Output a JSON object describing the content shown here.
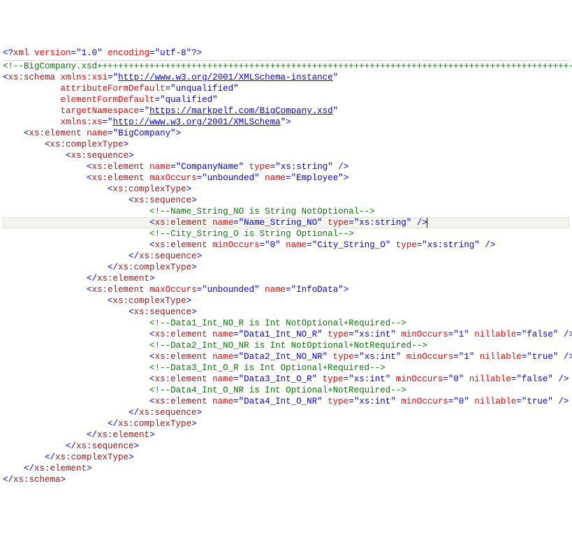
{
  "code_lines": [
    {
      "indent": 0,
      "tokens": [
        {
          "t": "<?",
          "c": "p"
        },
        {
          "t": "xml ",
          "c": "xml"
        },
        {
          "t": "version",
          "c": "attr"
        },
        {
          "t": "=",
          "c": "p"
        },
        {
          "t": "\"1.0\"",
          "c": "str"
        },
        {
          "t": " ",
          "c": "p"
        },
        {
          "t": "encoding",
          "c": "attr"
        },
        {
          "t": "=",
          "c": "p"
        },
        {
          "t": "\"utf-8\"",
          "c": "str"
        },
        {
          "t": "?>",
          "c": "p"
        }
      ]
    },
    {
      "indent": 0,
      "rule": true,
      "tokens": [
        {
          "t": "<!--",
          "c": "com"
        },
        {
          "t": "BigCompany.xsd++++++++++++++++++++++++++++++++++++++++++++++++++++++++++++++++++++++++++++++++++++++++++",
          "c": "com"
        },
        {
          "t": "-->",
          "c": "com"
        }
      ]
    },
    {
      "indent": 0,
      "tokens": [
        {
          "t": "<",
          "c": "p"
        },
        {
          "t": "xs:schema",
          "c": "tag"
        },
        {
          "t": " ",
          "c": "p"
        },
        {
          "t": "xmlns:xsi",
          "c": "attr"
        },
        {
          "t": "=",
          "c": "p"
        },
        {
          "t": "\"",
          "c": "p"
        },
        {
          "t": "http://www.w3.org/2001/XMLSchema-instance",
          "c": "link"
        },
        {
          "t": "\"",
          "c": "p"
        }
      ]
    },
    {
      "indent": 11,
      "tokens": [
        {
          "t": "attributeFormDefault",
          "c": "attr"
        },
        {
          "t": "=",
          "c": "p"
        },
        {
          "t": "\"unqualified\"",
          "c": "str"
        }
      ]
    },
    {
      "indent": 11,
      "tokens": [
        {
          "t": "elementFormDefault",
          "c": "attr"
        },
        {
          "t": "=",
          "c": "p"
        },
        {
          "t": "\"qualified\"",
          "c": "str"
        }
      ]
    },
    {
      "indent": 11,
      "tokens": [
        {
          "t": "targetNamespace",
          "c": "attr"
        },
        {
          "t": "=",
          "c": "p"
        },
        {
          "t": "\"",
          "c": "p"
        },
        {
          "t": "https://markpelf.com/BigCompany.xsd",
          "c": "link"
        },
        {
          "t": "\"",
          "c": "p"
        }
      ]
    },
    {
      "indent": 11,
      "tokens": [
        {
          "t": "xmlns:xs",
          "c": "attr"
        },
        {
          "t": "=",
          "c": "p"
        },
        {
          "t": "\"",
          "c": "p"
        },
        {
          "t": "http://www.w3.org/2001/XMLSchema",
          "c": "link"
        },
        {
          "t": "\"",
          "c": "p"
        },
        {
          "t": ">",
          "c": "p"
        }
      ]
    },
    {
      "indent": 4,
      "tokens": [
        {
          "t": "<",
          "c": "p"
        },
        {
          "t": "xs:element",
          "c": "tag"
        },
        {
          "t": " ",
          "c": "p"
        },
        {
          "t": "name",
          "c": "attr"
        },
        {
          "t": "=",
          "c": "p"
        },
        {
          "t": "\"BigCompany\"",
          "c": "str"
        },
        {
          "t": ">",
          "c": "p"
        }
      ]
    },
    {
      "indent": 8,
      "tokens": [
        {
          "t": "<",
          "c": "p"
        },
        {
          "t": "xs:complexType",
          "c": "tag"
        },
        {
          "t": ">",
          "c": "p"
        }
      ]
    },
    {
      "indent": 12,
      "tokens": [
        {
          "t": "<",
          "c": "p"
        },
        {
          "t": "xs:sequence",
          "c": "tag"
        },
        {
          "t": ">",
          "c": "p"
        }
      ]
    },
    {
      "indent": 16,
      "tokens": [
        {
          "t": "<",
          "c": "p"
        },
        {
          "t": "xs:element",
          "c": "tag"
        },
        {
          "t": " ",
          "c": "p"
        },
        {
          "t": "name",
          "c": "attr"
        },
        {
          "t": "=",
          "c": "p"
        },
        {
          "t": "\"CompanyName\"",
          "c": "str"
        },
        {
          "t": " ",
          "c": "p"
        },
        {
          "t": "type",
          "c": "attr"
        },
        {
          "t": "=",
          "c": "p"
        },
        {
          "t": "\"xs:string\"",
          "c": "str"
        },
        {
          "t": " />",
          "c": "p"
        }
      ]
    },
    {
      "indent": 16,
      "tokens": [
        {
          "t": "<",
          "c": "p"
        },
        {
          "t": "xs:element",
          "c": "tag"
        },
        {
          "t": " ",
          "c": "p"
        },
        {
          "t": "maxOccurs",
          "c": "attr"
        },
        {
          "t": "=",
          "c": "p"
        },
        {
          "t": "\"unbounded\"",
          "c": "str"
        },
        {
          "t": " ",
          "c": "p"
        },
        {
          "t": "name",
          "c": "attr"
        },
        {
          "t": "=",
          "c": "p"
        },
        {
          "t": "\"Employee\"",
          "c": "str"
        },
        {
          "t": ">",
          "c": "p"
        }
      ]
    },
    {
      "indent": 20,
      "tokens": [
        {
          "t": "<",
          "c": "p"
        },
        {
          "t": "xs:complexType",
          "c": "tag"
        },
        {
          "t": ">",
          "c": "p"
        }
      ]
    },
    {
      "indent": 24,
      "tokens": [
        {
          "t": "<",
          "c": "p"
        },
        {
          "t": "xs:sequence",
          "c": "tag"
        },
        {
          "t": ">",
          "c": "p"
        }
      ]
    },
    {
      "indent": 28,
      "tokens": [
        {
          "t": "<!--",
          "c": "com"
        },
        {
          "t": "Name_String_NO is String NotOptional",
          "c": "com"
        },
        {
          "t": "-->",
          "c": "com"
        }
      ]
    },
    {
      "indent": 28,
      "highlight": true,
      "cursor_at_end": true,
      "tokens": [
        {
          "t": "<",
          "c": "p"
        },
        {
          "t": "xs:element",
          "c": "tag"
        },
        {
          "t": " ",
          "c": "p"
        },
        {
          "t": "name",
          "c": "attr"
        },
        {
          "t": "=",
          "c": "p"
        },
        {
          "t": "\"Name_String_NO\"",
          "c": "str"
        },
        {
          "t": " ",
          "c": "p"
        },
        {
          "t": "type",
          "c": "attr"
        },
        {
          "t": "=",
          "c": "p"
        },
        {
          "t": "\"xs:string\"",
          "c": "str"
        },
        {
          "t": " />",
          "c": "p"
        }
      ]
    },
    {
      "indent": 28,
      "tokens": [
        {
          "t": "<!--",
          "c": "com"
        },
        {
          "t": "City_String_O is String Optional",
          "c": "com"
        },
        {
          "t": "-->",
          "c": "com"
        }
      ]
    },
    {
      "indent": 28,
      "tokens": [
        {
          "t": "<",
          "c": "p"
        },
        {
          "t": "xs:element",
          "c": "tag"
        },
        {
          "t": " ",
          "c": "p"
        },
        {
          "t": "minOccurs",
          "c": "attr"
        },
        {
          "t": "=",
          "c": "p"
        },
        {
          "t": "\"0\"",
          "c": "str"
        },
        {
          "t": " ",
          "c": "p"
        },
        {
          "t": "name",
          "c": "attr"
        },
        {
          "t": "=",
          "c": "p"
        },
        {
          "t": "\"City_String_O\"",
          "c": "str"
        },
        {
          "t": " ",
          "c": "p"
        },
        {
          "t": "type",
          "c": "attr"
        },
        {
          "t": "=",
          "c": "p"
        },
        {
          "t": "\"xs:string\"",
          "c": "str"
        },
        {
          "t": " />",
          "c": "p"
        }
      ]
    },
    {
      "indent": 24,
      "tokens": [
        {
          "t": "</",
          "c": "p"
        },
        {
          "t": "xs:sequence",
          "c": "tag"
        },
        {
          "t": ">",
          "c": "p"
        }
      ]
    },
    {
      "indent": 20,
      "tokens": [
        {
          "t": "</",
          "c": "p"
        },
        {
          "t": "xs:complexType",
          "c": "tag"
        },
        {
          "t": ">",
          "c": "p"
        }
      ]
    },
    {
      "indent": 16,
      "tokens": [
        {
          "t": "</",
          "c": "p"
        },
        {
          "t": "xs:element",
          "c": "tag"
        },
        {
          "t": ">",
          "c": "p"
        }
      ]
    },
    {
      "indent": 16,
      "tokens": [
        {
          "t": "<",
          "c": "p"
        },
        {
          "t": "xs:element",
          "c": "tag"
        },
        {
          "t": " ",
          "c": "p"
        },
        {
          "t": "maxOccurs",
          "c": "attr"
        },
        {
          "t": "=",
          "c": "p"
        },
        {
          "t": "\"unbounded\"",
          "c": "str"
        },
        {
          "t": " ",
          "c": "p"
        },
        {
          "t": "name",
          "c": "attr"
        },
        {
          "t": "=",
          "c": "p"
        },
        {
          "t": "\"InfoData\"",
          "c": "str"
        },
        {
          "t": ">",
          "c": "p"
        }
      ]
    },
    {
      "indent": 20,
      "tokens": [
        {
          "t": "<",
          "c": "p"
        },
        {
          "t": "xs:complexType",
          "c": "tag"
        },
        {
          "t": ">",
          "c": "p"
        }
      ]
    },
    {
      "indent": 24,
      "tokens": [
        {
          "t": "<",
          "c": "p"
        },
        {
          "t": "xs:sequence",
          "c": "tag"
        },
        {
          "t": ">",
          "c": "p"
        }
      ]
    },
    {
      "indent": 28,
      "tokens": [
        {
          "t": "<!--",
          "c": "com"
        },
        {
          "t": "Data1_Int_NO_R is Int NotOptional+Required",
          "c": "com"
        },
        {
          "t": "-->",
          "c": "com"
        }
      ]
    },
    {
      "indent": 28,
      "tokens": [
        {
          "t": "<",
          "c": "p"
        },
        {
          "t": "xs:element",
          "c": "tag"
        },
        {
          "t": " ",
          "c": "p"
        },
        {
          "t": "name",
          "c": "attr"
        },
        {
          "t": "=",
          "c": "p"
        },
        {
          "t": "\"Data1_Int_NO_R\"",
          "c": "str"
        },
        {
          "t": " ",
          "c": "p"
        },
        {
          "t": "type",
          "c": "attr"
        },
        {
          "t": "=",
          "c": "p"
        },
        {
          "t": "\"xs:int\"",
          "c": "str"
        },
        {
          "t": " ",
          "c": "p"
        },
        {
          "t": "minOccurs",
          "c": "attr"
        },
        {
          "t": "=",
          "c": "p"
        },
        {
          "t": "\"1\"",
          "c": "str"
        },
        {
          "t": " ",
          "c": "p"
        },
        {
          "t": "nillable",
          "c": "attr"
        },
        {
          "t": "=",
          "c": "p"
        },
        {
          "t": "\"false\"",
          "c": "str"
        },
        {
          "t": " />",
          "c": "p"
        }
      ]
    },
    {
      "indent": 28,
      "tokens": [
        {
          "t": "<!--",
          "c": "com"
        },
        {
          "t": "Data2_Int_NO_NR is Int NotOptional+NotRequired",
          "c": "com"
        },
        {
          "t": "-->",
          "c": "com"
        }
      ]
    },
    {
      "indent": 28,
      "tokens": [
        {
          "t": "<",
          "c": "p"
        },
        {
          "t": "xs:element",
          "c": "tag"
        },
        {
          "t": " ",
          "c": "p"
        },
        {
          "t": "name",
          "c": "attr"
        },
        {
          "t": "=",
          "c": "p"
        },
        {
          "t": "\"Data2_Int_NO_NR\"",
          "c": "str"
        },
        {
          "t": " ",
          "c": "p"
        },
        {
          "t": "type",
          "c": "attr"
        },
        {
          "t": "=",
          "c": "p"
        },
        {
          "t": "\"xs:int\"",
          "c": "str"
        },
        {
          "t": " ",
          "c": "p"
        },
        {
          "t": "minOccurs",
          "c": "attr"
        },
        {
          "t": "=",
          "c": "p"
        },
        {
          "t": "\"1\"",
          "c": "str"
        },
        {
          "t": " ",
          "c": "p"
        },
        {
          "t": "nillable",
          "c": "attr"
        },
        {
          "t": "=",
          "c": "p"
        },
        {
          "t": "\"true\"",
          "c": "str"
        },
        {
          "t": " />",
          "c": "p"
        }
      ]
    },
    {
      "indent": 28,
      "tokens": [
        {
          "t": "<!--",
          "c": "com"
        },
        {
          "t": "Data3_Int_O_R is Int Optional+Required",
          "c": "com"
        },
        {
          "t": "-->",
          "c": "com"
        }
      ]
    },
    {
      "indent": 28,
      "tokens": [
        {
          "t": "<",
          "c": "p"
        },
        {
          "t": "xs:element",
          "c": "tag"
        },
        {
          "t": " ",
          "c": "p"
        },
        {
          "t": "name",
          "c": "attr"
        },
        {
          "t": "=",
          "c": "p"
        },
        {
          "t": "\"Data3_Int_O_R\"",
          "c": "str"
        },
        {
          "t": " ",
          "c": "p"
        },
        {
          "t": "type",
          "c": "attr"
        },
        {
          "t": "=",
          "c": "p"
        },
        {
          "t": "\"xs:int\"",
          "c": "str"
        },
        {
          "t": " ",
          "c": "p"
        },
        {
          "t": "minOccurs",
          "c": "attr"
        },
        {
          "t": "=",
          "c": "p"
        },
        {
          "t": "\"0\"",
          "c": "str"
        },
        {
          "t": " ",
          "c": "p"
        },
        {
          "t": "nillable",
          "c": "attr"
        },
        {
          "t": "=",
          "c": "p"
        },
        {
          "t": "\"false\"",
          "c": "str"
        },
        {
          "t": " />",
          "c": "p"
        }
      ]
    },
    {
      "indent": 28,
      "tokens": [
        {
          "t": "<!--",
          "c": "com"
        },
        {
          "t": "Data4_Int_O_NR is Int Optional+NotRequired",
          "c": "com"
        },
        {
          "t": "-->",
          "c": "com"
        }
      ]
    },
    {
      "indent": 28,
      "tokens": [
        {
          "t": "<",
          "c": "p"
        },
        {
          "t": "xs:element",
          "c": "tag"
        },
        {
          "t": " ",
          "c": "p"
        },
        {
          "t": "name",
          "c": "attr"
        },
        {
          "t": "=",
          "c": "p"
        },
        {
          "t": "\"Data4_Int_O_NR\"",
          "c": "str"
        },
        {
          "t": " ",
          "c": "p"
        },
        {
          "t": "type",
          "c": "attr"
        },
        {
          "t": "=",
          "c": "p"
        },
        {
          "t": "\"xs:int\"",
          "c": "str"
        },
        {
          "t": " ",
          "c": "p"
        },
        {
          "t": "minOccurs",
          "c": "attr"
        },
        {
          "t": "=",
          "c": "p"
        },
        {
          "t": "\"0\"",
          "c": "str"
        },
        {
          "t": " ",
          "c": "p"
        },
        {
          "t": "nillable",
          "c": "attr"
        },
        {
          "t": "=",
          "c": "p"
        },
        {
          "t": "\"true\"",
          "c": "str"
        },
        {
          "t": " />",
          "c": "p"
        }
      ]
    },
    {
      "indent": 24,
      "tokens": [
        {
          "t": "</",
          "c": "p"
        },
        {
          "t": "xs:sequence",
          "c": "tag"
        },
        {
          "t": ">",
          "c": "p"
        }
      ]
    },
    {
      "indent": 20,
      "tokens": [
        {
          "t": "</",
          "c": "p"
        },
        {
          "t": "xs:complexType",
          "c": "tag"
        },
        {
          "t": ">",
          "c": "p"
        }
      ]
    },
    {
      "indent": 16,
      "tokens": [
        {
          "t": "</",
          "c": "p"
        },
        {
          "t": "xs:element",
          "c": "tag"
        },
        {
          "t": ">",
          "c": "p"
        }
      ]
    },
    {
      "indent": 12,
      "tokens": [
        {
          "t": "</",
          "c": "p"
        },
        {
          "t": "xs:sequence",
          "c": "tag"
        },
        {
          "t": ">",
          "c": "p"
        }
      ]
    },
    {
      "indent": 8,
      "tokens": [
        {
          "t": "</",
          "c": "p"
        },
        {
          "t": "xs:complexType",
          "c": "tag"
        },
        {
          "t": ">",
          "c": "p"
        }
      ]
    },
    {
      "indent": 4,
      "tokens": [
        {
          "t": "</",
          "c": "p"
        },
        {
          "t": "xs:element",
          "c": "tag"
        },
        {
          "t": ">",
          "c": "p"
        }
      ]
    },
    {
      "indent": 0,
      "tokens": [
        {
          "t": "</",
          "c": "p"
        },
        {
          "t": "xs:schema",
          "c": "tag"
        },
        {
          "t": ">",
          "c": "p"
        }
      ]
    }
  ]
}
